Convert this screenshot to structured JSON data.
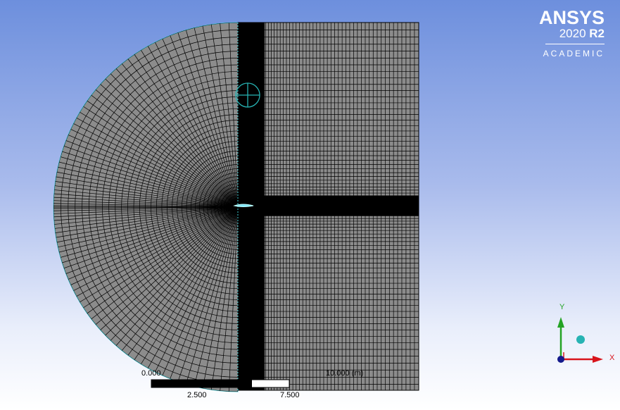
{
  "logo": {
    "brand": "ANSYS",
    "version_year": "2020",
    "version_release": "R2",
    "edition": "ACADEMIC"
  },
  "scale_bar": {
    "labels_top": [
      "0.000",
      "10.000 (m)"
    ],
    "labels_bottom": [
      "2.500",
      "7.500"
    ]
  },
  "triad": {
    "x_label": "X",
    "y_label": "Y",
    "x_color": "#d8141b",
    "y_color": "#24a324",
    "z_color": "#141a8c",
    "iso_color": "#27b3b3"
  },
  "colors": {
    "mesh_fill": "#8c8c8c",
    "mesh_line": "#000000",
    "edge_highlight": "#3ac7d1"
  }
}
